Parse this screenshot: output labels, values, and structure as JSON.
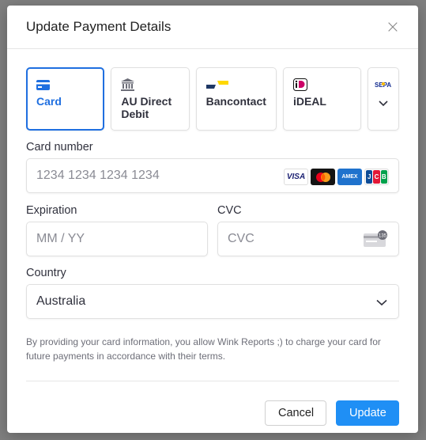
{
  "modal": {
    "title": "Update Payment Details",
    "close_label": "×"
  },
  "payment_methods": [
    {
      "label": "Card",
      "icon": "card-icon",
      "selected": true
    },
    {
      "label": "AU Direct Debit",
      "icon": "bank-icon",
      "selected": false
    },
    {
      "label": "Bancontact",
      "icon": "bancontact-logo",
      "selected": false
    },
    {
      "label": "iDEAL",
      "icon": "ideal-logo",
      "selected": false
    },
    {
      "label": "SEPA",
      "icon": "sepa-logo",
      "selected": false
    }
  ],
  "card_number": {
    "label": "Card number",
    "placeholder": "1234 1234 1234 1234",
    "brands": [
      "VISA",
      "Mastercard",
      "AMEX",
      "JCB"
    ]
  },
  "expiration": {
    "label": "Expiration",
    "placeholder": "MM / YY"
  },
  "cvc": {
    "label": "CVC",
    "placeholder": "CVC",
    "icon_text": "135"
  },
  "country": {
    "label": "Country",
    "value": "Australia"
  },
  "terms": "By providing your card information, you allow Wink Reports ;) to charge your card for future payments in accordance with their terms.",
  "footer": {
    "cancel_label": "Cancel",
    "update_label": "Update"
  },
  "colors": {
    "accent": "#1f6fe0",
    "update_button": "#1f8ff5"
  }
}
